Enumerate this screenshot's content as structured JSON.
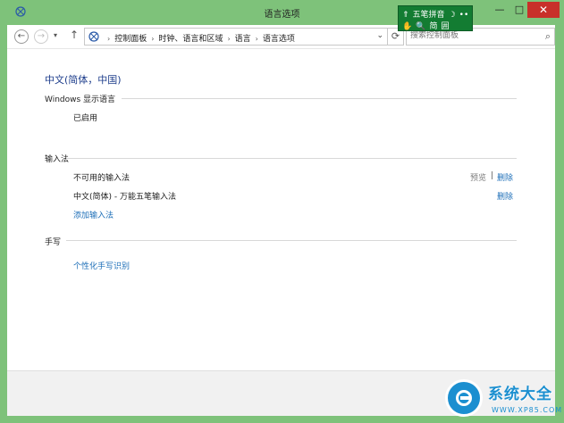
{
  "window": {
    "title": "语言选项",
    "minimize_glyph": "—",
    "maximize_glyph": "□",
    "close_glyph": "✕"
  },
  "ime_toolbar": {
    "row1": [
      "⇑",
      "五笔拼音",
      "☽",
      "••"
    ],
    "row2": [
      "✋",
      "🔍",
      "简",
      "囲"
    ]
  },
  "address": {
    "breadcrumb": [
      "控制面板",
      "时钟、语言和区域",
      "语言",
      "语言选项"
    ],
    "search_placeholder": "搜索控制面板",
    "back_glyph": "←",
    "forward_glyph": "→",
    "up_glyph": "↑",
    "refresh_glyph": "⟳",
    "search_glyph": "⌕",
    "dropdown_glyph": "⌄",
    "recent_glyph": "▾",
    "crumb_sep": "›"
  },
  "content": {
    "page_title": "中文(简体，中国)",
    "display_language": {
      "header": "Windows 显示语言",
      "value": "已启用"
    },
    "input_methods": {
      "header": "输入法",
      "items": [
        {
          "name": "不可用的输入法",
          "preview": "预览",
          "separator": "|",
          "delete": "删除"
        },
        {
          "name": "中文(简体) - 万能五笔输入法",
          "delete": "删除"
        }
      ],
      "add_label": "添加输入法"
    },
    "handwriting": {
      "header": "手写",
      "personalize_label": "个性化手写识别"
    }
  },
  "watermark": {
    "text": "系统大全",
    "url": "WWW.XP85.COM"
  },
  "colors": {
    "titlebar": "#7ec27a",
    "link": "#1e6fb8",
    "ime_bar": "#137c32",
    "watermark": "#1b8fd0"
  }
}
